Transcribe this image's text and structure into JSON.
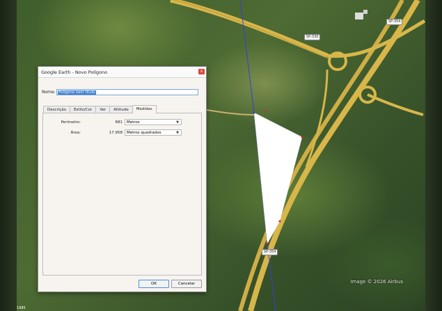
{
  "map": {
    "road_labels": [
      "SP-330",
      "SP-354",
      "SP-354"
    ],
    "watermark": "Image © 2026 Airbus",
    "year": "1985"
  },
  "dialog": {
    "title": "Google Earth - Novo Polígono",
    "close_glyph": "x",
    "name_label": "Nome:",
    "name_value": "Polígono sem título",
    "tabs": [
      "Descrição",
      "Estilo/Cor",
      "Ver",
      "Altitude",
      "Medidas"
    ],
    "active_tab": "Medidas",
    "measurements": {
      "perimeter_label": "Perímetro:",
      "perimeter_value": "681",
      "perimeter_unit": "Metros",
      "area_label": "Área:",
      "area_value": "17.958",
      "area_unit": "Metros quadrados"
    },
    "ok_label": "OK",
    "cancel_label": "Cancelar"
  },
  "colors": {
    "selection": "#3d7fd0",
    "close": "#d9463c",
    "road": "#d8b64a",
    "polygon": "#ffffff",
    "path_line": "#3340d8"
  },
  "icons": [
    "close-icon",
    "dropdown-arrow-icon"
  ]
}
